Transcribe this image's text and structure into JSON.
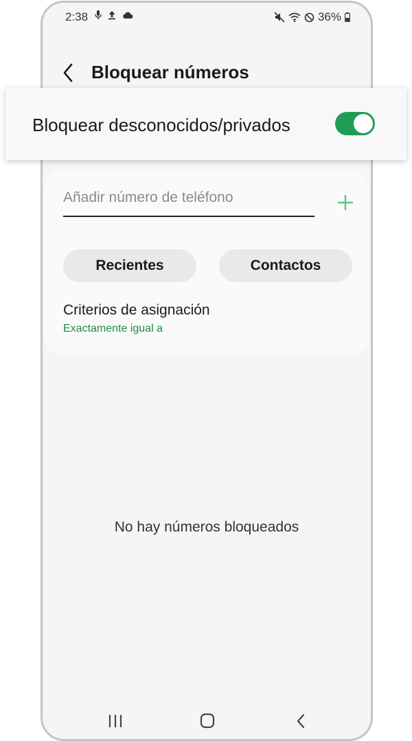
{
  "status_bar": {
    "time": "2:38",
    "battery": "36%"
  },
  "header": {
    "title": "Bloquear números"
  },
  "toggle_row": {
    "label": "Bloquear desconocidos/privados",
    "enabled": true
  },
  "block_form": {
    "phone_placeholder": "Añadir número de teléfono",
    "phone_value": "",
    "recent_label": "Recientes",
    "contacts_label": "Contactos",
    "criteria_title": "Criterios de asignación",
    "criteria_value": "Exactamente igual a"
  },
  "empty_state": {
    "text": "No hay números bloqueados"
  },
  "colors": {
    "accent_green": "#1f9d55",
    "criteria_green": "#1f8a4c",
    "add_icon_green": "#5cc47c"
  },
  "icons": {
    "status_left": [
      "microphone-icon",
      "upload-icon",
      "cloud-icon"
    ],
    "status_right": [
      "mute-vibrate-icon",
      "wifi-icon",
      "do-not-disturb-icon",
      "battery-icon"
    ],
    "nav": [
      "recent-apps-icon",
      "home-icon",
      "back-nav-icon"
    ]
  }
}
